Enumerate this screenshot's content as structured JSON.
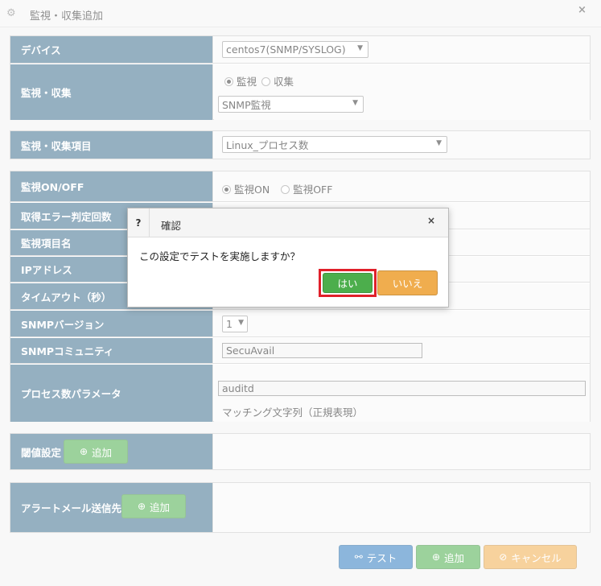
{
  "window": {
    "title": "監視・収集追加",
    "close": "×"
  },
  "device": {
    "label": "デバイス",
    "value": "centos7(SNMP/SYSLOG)"
  },
  "monitor": {
    "label": "監視・収集",
    "radio_monitor": "監視",
    "radio_collect": "収集",
    "type_value": "SNMP監視"
  },
  "item": {
    "label": "監視・収集項目",
    "value": "Linux_プロセス数"
  },
  "rows": {
    "onoff_label": "監視ON/OFF",
    "on": "監視ON",
    "off": "監視OFF",
    "err_label": "取得エラー判定回数",
    "name_label": "監視項目名",
    "ip_label": "IPアドレス",
    "timeout_label": "タイムアウト（秒）",
    "snmpver_label": "SNMPバージョン",
    "snmpver_value": "1",
    "community_label": "SNMPコミュニティ",
    "community_value": "SecuAvail",
    "param_label": "プロセス数パラメータ",
    "param_value": "auditd",
    "param_note": "マッチング文字列（正規表現）"
  },
  "threshold": {
    "label": "閾値設定",
    "add": "追加"
  },
  "alert": {
    "label": "アラートメール送信先",
    "add": "追加"
  },
  "footer": {
    "test": "テスト",
    "add": "追加",
    "cancel": "キャンセル"
  },
  "dialog": {
    "icon": "?",
    "title": "確認",
    "close": "×",
    "message": "この設定でテストを実施しますか？",
    "yes": "はい",
    "no": "いいえ"
  }
}
